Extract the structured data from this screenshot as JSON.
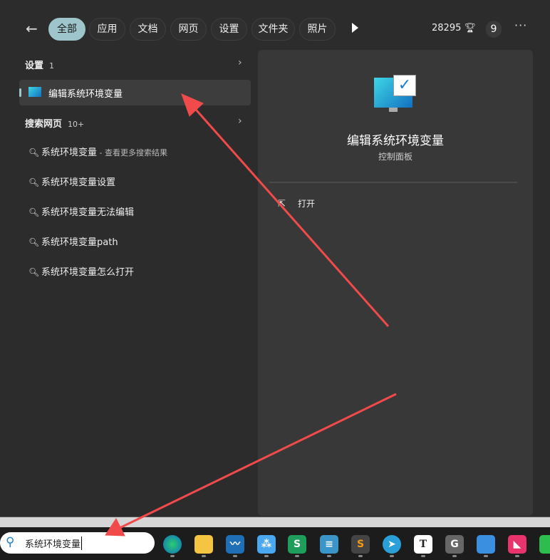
{
  "top": {
    "tabs": [
      "全部",
      "应用",
      "文档",
      "网页",
      "设置",
      "文件夹",
      "照片"
    ],
    "points": "28295",
    "badge": "9",
    "more": "···"
  },
  "settings": {
    "title": "设置",
    "count": "1",
    "item": "编辑系统环境变量"
  },
  "web": {
    "title": "搜索网页",
    "count": "10+",
    "results": [
      {
        "text": "系统环境变量",
        "suffix": " - 查看更多搜索结果"
      },
      {
        "text": "系统环境变量设置",
        "suffix": ""
      },
      {
        "text": "系统环境变量无法编辑",
        "suffix": ""
      },
      {
        "text": "系统环境变量path",
        "suffix": ""
      },
      {
        "text": "系统环境变量怎么打开",
        "suffix": ""
      }
    ]
  },
  "preview": {
    "title": "编辑系统环境变量",
    "subtitle": "控制面板",
    "action": "打开"
  },
  "taskbar": {
    "search_value": "系统环境变量",
    "apps": [
      "edge",
      "file-explorer",
      "app-wave",
      "app-network",
      "wps-sheets",
      "notepad",
      "sublime-text",
      "telegram",
      "typora",
      "app-g",
      "app-blue",
      "app-pink",
      "wechat"
    ]
  },
  "accent": "#9fc5cc",
  "arrow_color": "#f04a4a"
}
